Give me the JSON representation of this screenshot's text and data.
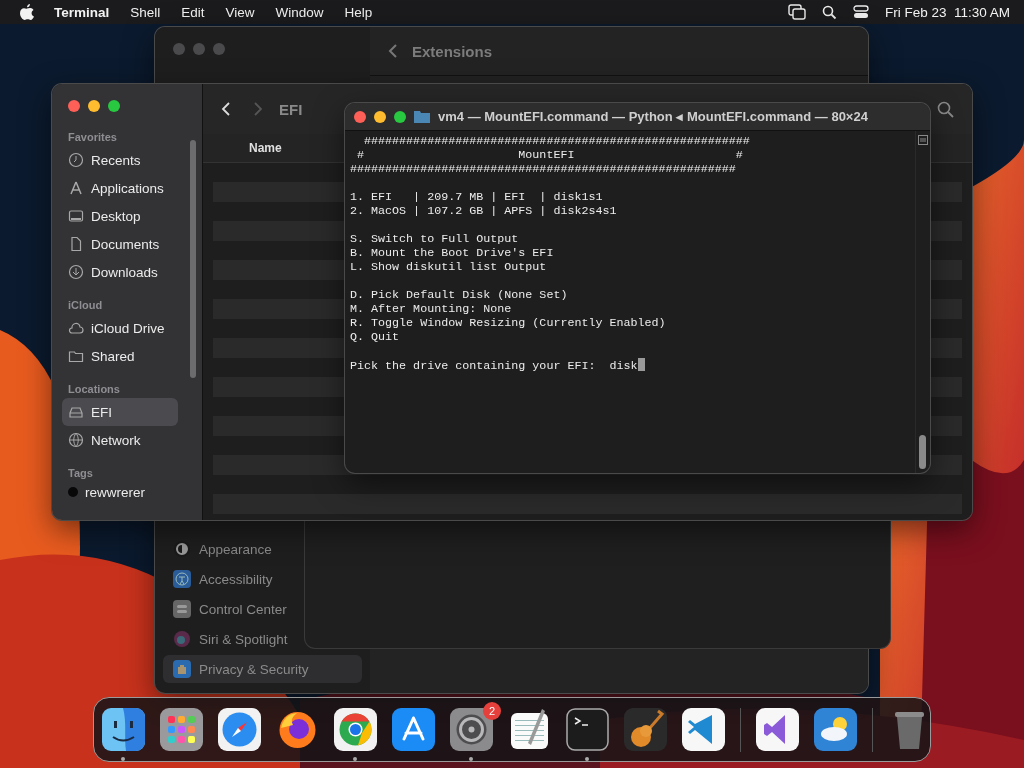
{
  "menubar": {
    "app": "Terminal",
    "menus": [
      "Shell",
      "Edit",
      "View",
      "Window",
      "Help"
    ],
    "clock": "Fri Feb 23  11:30 AM"
  },
  "settings_window": {
    "title": "Extensions",
    "sidebar": [
      {
        "label": "Appearance",
        "kind": "appearance",
        "selected": false
      },
      {
        "label": "Accessibility",
        "kind": "accessibility",
        "selected": false
      },
      {
        "label": "Control Center",
        "kind": "control",
        "selected": false
      },
      {
        "label": "Siri & Spotlight",
        "kind": "siri",
        "selected": false
      },
      {
        "label": "Privacy & Security",
        "kind": "privacy",
        "selected": true
      }
    ]
  },
  "finder_window": {
    "title": "EFI",
    "column": "Name",
    "sections": [
      {
        "heading": "Favorites",
        "items": [
          {
            "label": "Recents",
            "kind": "recents",
            "selected": false
          },
          {
            "label": "Applications",
            "kind": "applications",
            "selected": false
          },
          {
            "label": "Desktop",
            "kind": "desktop",
            "selected": false
          },
          {
            "label": "Documents",
            "kind": "documents",
            "selected": false
          },
          {
            "label": "Downloads",
            "kind": "downloads",
            "selected": false
          }
        ]
      },
      {
        "heading": "iCloud",
        "items": [
          {
            "label": "iCloud Drive",
            "kind": "cloud",
            "selected": false
          },
          {
            "label": "Shared",
            "kind": "shared",
            "selected": false
          }
        ]
      },
      {
        "heading": "Locations",
        "items": [
          {
            "label": "EFI",
            "kind": "drive",
            "selected": true
          },
          {
            "label": "Network",
            "kind": "network",
            "selected": false
          }
        ]
      },
      {
        "heading": "Tags",
        "items": [
          {
            "label": "rewwrerer",
            "kind": "tag",
            "selected": false
          }
        ]
      }
    ]
  },
  "terminal": {
    "title": "vm4 — MountEFI.command — Python ◂ MountEFI.command — 80×24",
    "blocks": [
      [
        "  #######################################################",
        " #                      MountEFI                       #",
        "#######################################################"
      ],
      [
        "1. EFI   | 209.7 MB | EFI  | disk1s1",
        "2. MacOS | 107.2 GB | APFS | disk2s4s1"
      ],
      [
        "S. Switch to Full Output",
        "B. Mount the Boot Drive's EFI",
        "L. Show diskutil list Output"
      ],
      [
        "D. Pick Default Disk (None Set)",
        "M. After Mounting: None",
        "R. Toggle Window Resizing (Currently Enabled)",
        "Q. Quit"
      ]
    ],
    "prompt": "Pick the drive containing your EFI:  disk"
  },
  "dock": {
    "items": [
      {
        "kind": "finder",
        "running": true
      },
      {
        "kind": "launchpad",
        "running": false
      },
      {
        "kind": "safari",
        "running": false
      },
      {
        "kind": "firefox",
        "running": false
      },
      {
        "kind": "chrome",
        "running": true
      },
      {
        "kind": "appstore",
        "running": false
      },
      {
        "kind": "settings",
        "running": true,
        "badge": "2"
      },
      {
        "kind": "textedit",
        "running": false
      },
      {
        "kind": "terminal",
        "running": true
      },
      {
        "kind": "garageband",
        "running": false
      },
      {
        "kind": "vscode",
        "running": false
      },
      {
        "kind": "separator"
      },
      {
        "kind": "visualstudio",
        "running": false
      },
      {
        "kind": "weather",
        "running": false
      },
      {
        "kind": "separator"
      },
      {
        "kind": "trash",
        "running": false
      }
    ]
  }
}
